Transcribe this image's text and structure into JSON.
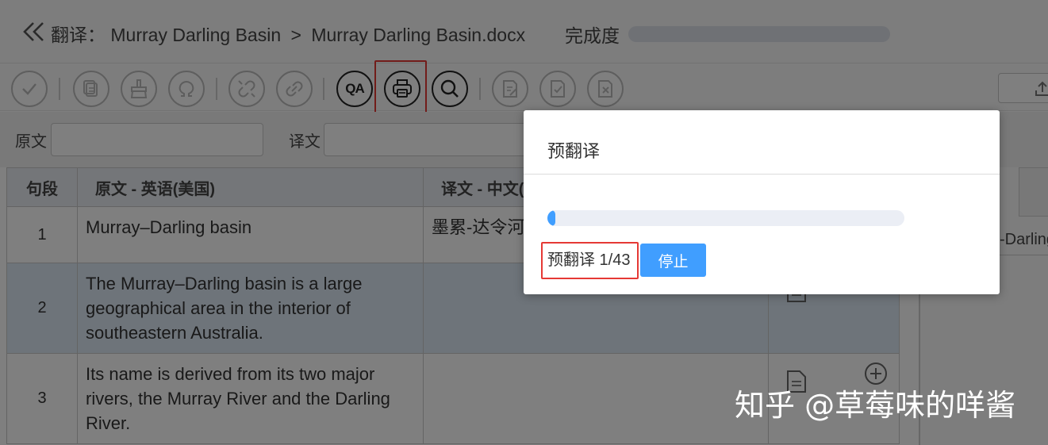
{
  "header": {
    "title_prefix": "翻译：",
    "project": "Murray Darling Basin",
    "separator": ">",
    "file": "Murray Darling Basin.docx",
    "progress_label": "完成度",
    "progress_fraction": 0
  },
  "toolbar": {
    "buttons": [
      {
        "name": "confirm-icon"
      },
      {
        "name": "copy-source-icon"
      },
      {
        "name": "clear-icon"
      },
      {
        "name": "special-char-icon"
      },
      {
        "name": "unlink-icon"
      },
      {
        "name": "link-icon"
      },
      {
        "name": "qa-icon",
        "label": "QA"
      },
      {
        "name": "print-icon"
      },
      {
        "name": "search-icon"
      },
      {
        "name": "edit-doc-icon"
      },
      {
        "name": "approve-doc-icon"
      },
      {
        "name": "reject-doc-icon"
      }
    ]
  },
  "filters": {
    "source_label": "原文",
    "source_value": "",
    "target_label": "译文",
    "target_value": ""
  },
  "table": {
    "headers": [
      "句段",
      "原文 - 英语(美国)",
      "译文 - 中文("
    ],
    "rows": [
      {
        "seg": "1",
        "source": "Murray–Darling basin",
        "target": "墨累-达令河"
      },
      {
        "seg": "2",
        "source": "The Murray–Darling basin is a large geographical area in the interior of southeastern Australia.",
        "target": ""
      },
      {
        "seg": "3",
        "source": "Its name is derived from its two major rivers, the Murray River and the Darling River.",
        "target": ""
      }
    ]
  },
  "side_panel": {
    "text": "-Darling"
  },
  "modal": {
    "title": "预翻译",
    "progress_fraction": 0.0233,
    "status": "预翻译 1/43",
    "stop_label": "停止"
  },
  "watermark": "知乎 @草莓味的咩酱",
  "colors": {
    "accent": "#409eff",
    "highlight": "#e53935",
    "overlay": "#000000"
  }
}
